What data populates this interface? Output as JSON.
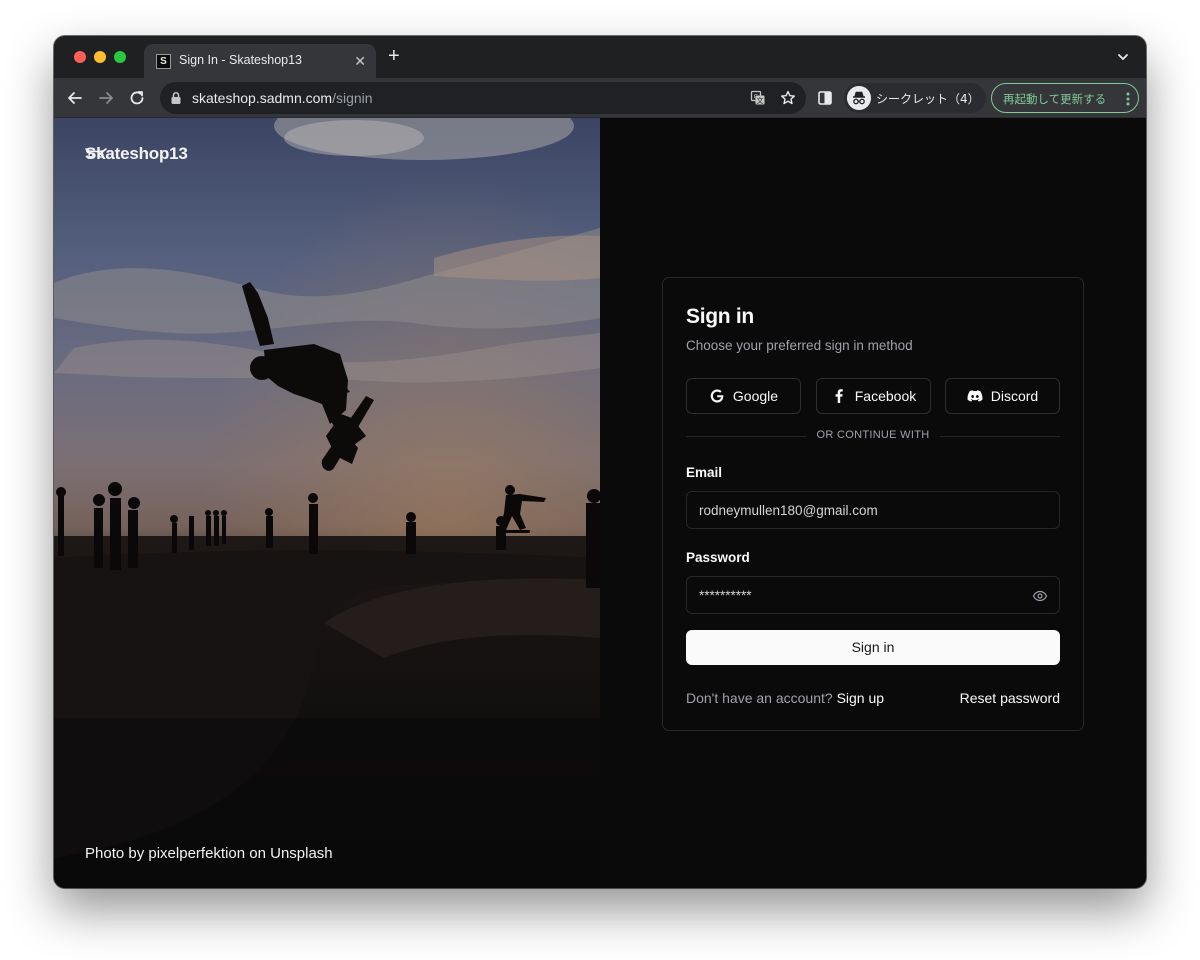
{
  "browser": {
    "tab": {
      "favicon": "S",
      "title": "Sign In - Skateshop13"
    },
    "address": {
      "host": "skateshop.sadmn.com",
      "path": "/signin"
    },
    "profile_label": "シークレット（4）",
    "restart_label": "再起動して更新する",
    "icons": {
      "back": "arrow-left-icon",
      "forward": "arrow-right-icon",
      "reload": "reload-icon",
      "lock": "lock-icon",
      "translate": "translate-icon",
      "bookmark": "star-icon",
      "side_panel": "side-panel-icon",
      "incognito": "incognito-icon",
      "menu": "kebab-menu-icon"
    }
  },
  "site": {
    "brand": "Skateshop13",
    "photo_credit": "Photo by pixelperfektion on Unsplash"
  },
  "signin": {
    "title": "Sign in",
    "subtitle": "Choose your preferred sign in method",
    "providers": [
      {
        "label": "Google",
        "icon": "google-icon"
      },
      {
        "label": "Facebook",
        "icon": "facebook-icon"
      },
      {
        "label": "Discord",
        "icon": "discord-icon"
      }
    ],
    "divider": "OR CONTINUE WITH",
    "email": {
      "label": "Email",
      "value": "rodneymullen180@gmail.com"
    },
    "password": {
      "label": "Password",
      "value": "**********"
    },
    "submit": "Sign in",
    "no_account": "Don't have an account?",
    "signup": "Sign up",
    "reset": "Reset password"
  },
  "colors": {
    "page_bg": "#0a0a0b",
    "card_border": "#27272a",
    "muted_text": "#a1a1aa",
    "primary_button": "#fafafa",
    "restart_accent": "#81c995"
  }
}
